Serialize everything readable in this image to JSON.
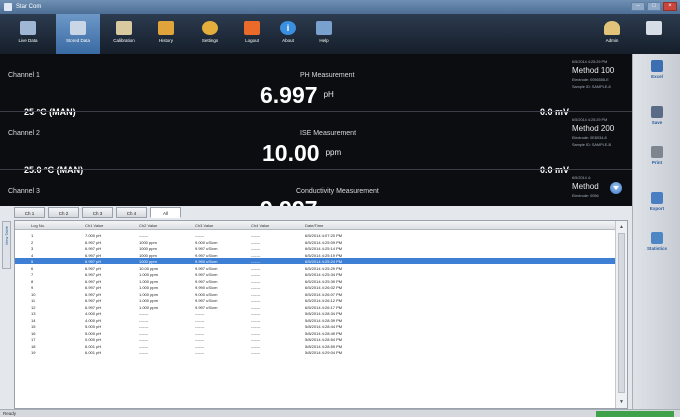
{
  "window": {
    "title": "Star Com"
  },
  "toolbar": {
    "items": [
      {
        "label": "Live Data",
        "icon": "live-data-icon"
      },
      {
        "label": "Stored Data",
        "icon": "stored-data-icon"
      },
      {
        "label": "Calibration",
        "icon": "calibration-icon"
      },
      {
        "label": "History",
        "icon": "history-icon"
      },
      {
        "label": "Settings",
        "icon": "settings-icon"
      },
      {
        "label": "Logout",
        "icon": "logout-icon"
      },
      {
        "label": "About",
        "icon": "about-icon"
      },
      {
        "label": "Help",
        "icon": "help-icon"
      }
    ],
    "admin_label": "Admin",
    "about_glyph": "i"
  },
  "channels": [
    {
      "name": "Channel 1",
      "type": "PH Measurement",
      "value": "6.997",
      "unit": "pH",
      "temp": "25 °C (MAN)",
      "mv": "0.0 mV",
      "date": "6/5/2014 4:25:29 PM",
      "method": "Method 100",
      "electrode": "Electrode: 0056555-E",
      "sample": "Sample ID: SAMPLE-8"
    },
    {
      "name": "Channel 2",
      "type": "ISE Measurement",
      "value": "10.00",
      "unit": "ppm",
      "temp": "25.0 °C (MAN)",
      "mv": "0.0 mV",
      "date": "6/5/2014 4:25:29 PM",
      "method": "Method 200",
      "electrode": "Electrode: 0E8034-8",
      "sample": "Sample ID: SAMPLE-B"
    },
    {
      "name": "Channel 3",
      "type": "Conductivity Measurement",
      "value": "9.997",
      "unit": "",
      "temp": "",
      "mv": "",
      "date": "6/5/2014 4:",
      "method": "Method",
      "electrode": "Electrode: 0056",
      "sample": ""
    }
  ],
  "right_panel": {
    "items": [
      {
        "label": "Excel",
        "icon": "excel-icon"
      },
      {
        "label": "Save",
        "icon": "save-icon"
      },
      {
        "label": "Print",
        "icon": "print-icon"
      },
      {
        "label": "Export",
        "icon": "export-icon"
      },
      {
        "label": "Statistics",
        "icon": "statistics-icon"
      }
    ]
  },
  "tabs": [
    "Ch 1",
    "Ch 2",
    "Ch 3",
    "Ch 4",
    "All"
  ],
  "active_tab": 4,
  "side_tab": "View Table",
  "table": {
    "columns": [
      "Log No.",
      "Ch1 Value",
      "Ch2 Value",
      "Ch3 Value",
      "Ch4 Value",
      "Date/Time"
    ],
    "selected_row": 4,
    "rows": [
      [
        "1",
        "7.000 pH",
        "-------",
        "-------",
        "-------",
        "6/5/2014 4:07:20 PM"
      ],
      [
        "2",
        "6.997 pH",
        "1000 ppm",
        "9.000 uS/cm",
        "-------",
        "6/5/2014 4:25:09 PM"
      ],
      [
        "3",
        "6.997 pH",
        "1000 ppm",
        "9.997 uS/cm",
        "-------",
        "6/5/2014 4:25:14 PM"
      ],
      [
        "4",
        "6.997 pH",
        "1000 ppm",
        "9.997 uS/cm",
        "-------",
        "6/5/2014 4:25:19 PM"
      ],
      [
        "5",
        "6.997 pH",
        "1000 ppm",
        "9.990 uS/cm",
        "-------",
        "6/5/2014 4:25:24 PM"
      ],
      [
        "6",
        "6.997 pH",
        "10.00 ppm",
        "9.997 uS/cm",
        "-------",
        "6/5/2014 4:25:29 PM"
      ],
      [
        "7",
        "6.997 pH",
        "1.000 ppm",
        "9.997 uS/cm",
        "-------",
        "6/5/2014 4:25:34 PM"
      ],
      [
        "8",
        "6.997 pH",
        "1.000 ppm",
        "9.997 uS/cm",
        "-------",
        "6/5/2014 4:25:39 PM"
      ],
      [
        "9",
        "6.997 pH",
        "1.000 ppm",
        "9.990 uS/cm",
        "-------",
        "6/5/2014 4:26:02 PM"
      ],
      [
        "10",
        "6.997 pH",
        "1.000 ppm",
        "9.000 uS/cm",
        "-------",
        "6/5/2014 4:26:07 PM"
      ],
      [
        "11",
        "6.997 pH",
        "1.000 ppm",
        "9.997 uS/cm",
        "-------",
        "6/5/2014 4:26:12 PM"
      ],
      [
        "12",
        "6.997 pH",
        "1.000 ppm",
        "9.997 uS/cm",
        "-------",
        "6/5/2014 4:26:17 PM"
      ],
      [
        "13",
        "4.000 pH",
        "-------",
        "-------",
        "-------",
        "5/8/2014 4:28:34 PM"
      ],
      [
        "14",
        "4.000 pH",
        "-------",
        "-------",
        "-------",
        "5/8/2014 4:28:39 PM"
      ],
      [
        "15",
        "5.000 pH",
        "-------",
        "-------",
        "-------",
        "5/8/2014 4:28:44 PM"
      ],
      [
        "16",
        "5.000 pH",
        "-------",
        "-------",
        "-------",
        "5/8/2014 4:28:49 PM"
      ],
      [
        "17",
        "0.000 pH",
        "-------",
        "-------",
        "-------",
        "5/8/2014 4:28:54 PM"
      ],
      [
        "18",
        "6.001 pH",
        "-------",
        "-------",
        "-------",
        "5/8/2014 4:28:59 PM"
      ],
      [
        "19",
        "6.001 pH",
        "-------",
        "-------",
        "-------",
        "5/8/2014 4:29:04 PM"
      ]
    ]
  },
  "status": {
    "text": "Ready"
  }
}
